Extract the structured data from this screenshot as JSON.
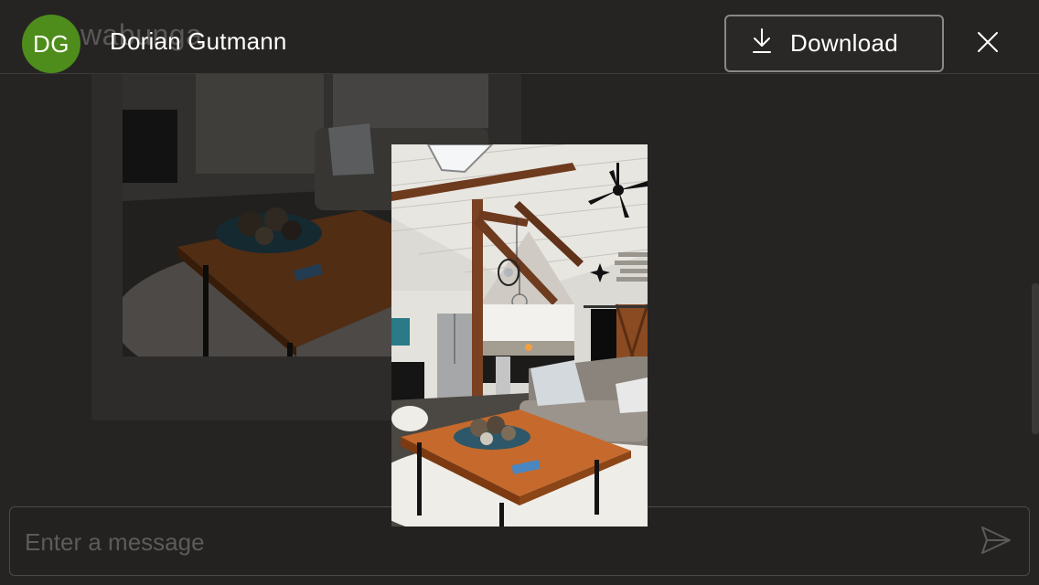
{
  "background": {
    "title_fragment": "wabunga",
    "compose": {
      "placeholder": "Enter a message"
    }
  },
  "viewer": {
    "sender": {
      "initials": "DG",
      "name": "Dorian Gutmann",
      "avatar_color": "#4e8d1b"
    },
    "download_label": "Download",
    "icons": {
      "download": "download-icon",
      "close": "close-icon",
      "send": "send-icon"
    }
  },
  "image": {
    "subject": "living-room-photo"
  }
}
